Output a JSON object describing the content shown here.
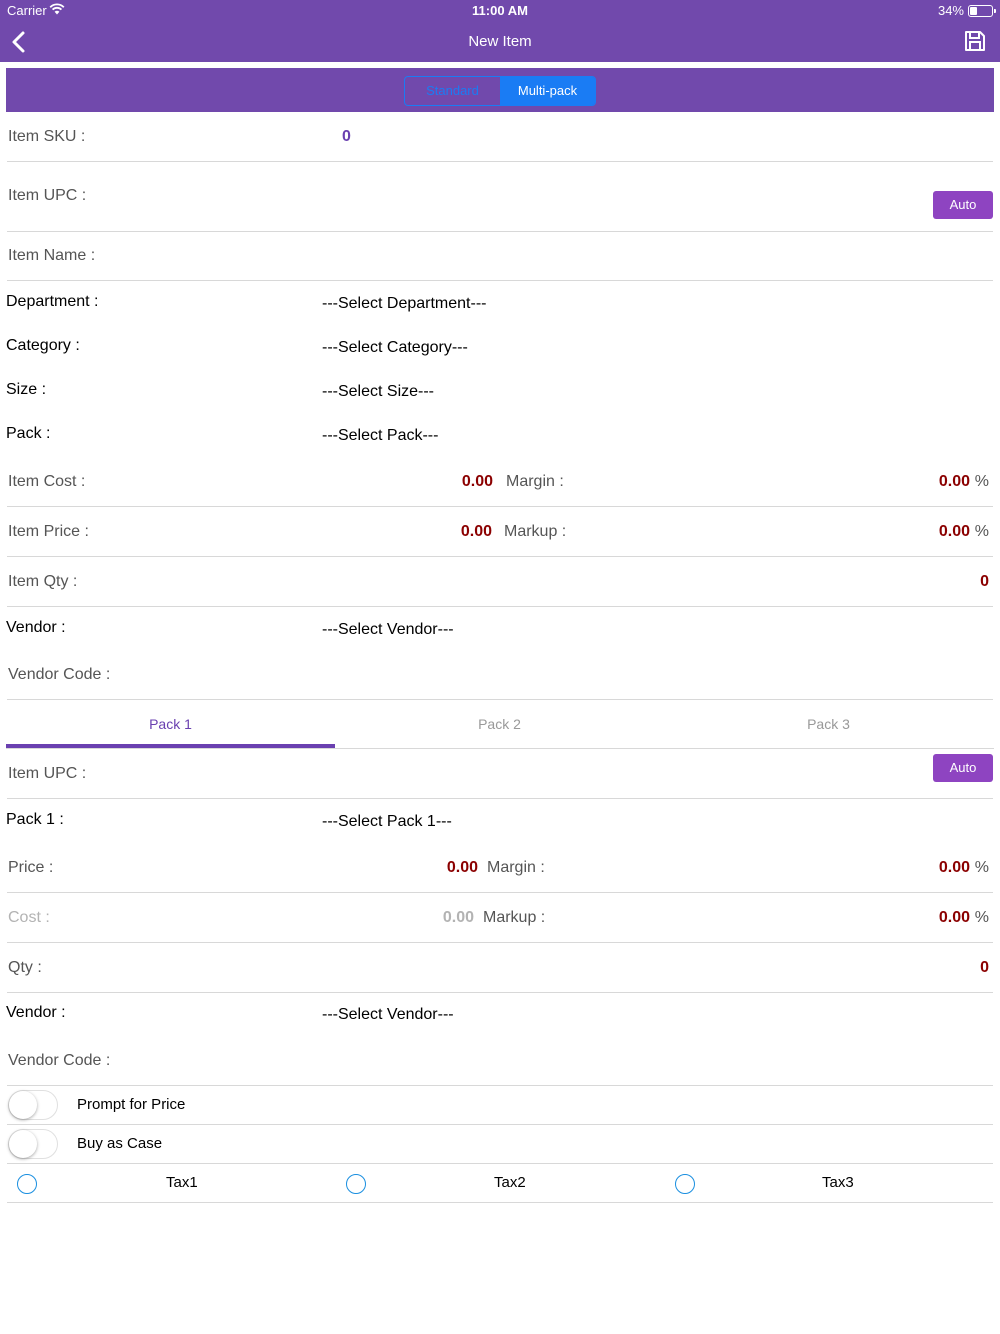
{
  "status_bar": {
    "carrier": "Carrier",
    "time": "11:00 AM",
    "battery": "34%"
  },
  "nav": {
    "title": "New Item",
    "back_icon": "chevron-left-icon",
    "save_icon": "floppy-disk-icon"
  },
  "segment": {
    "standard": "Standard",
    "multipack": "Multi-pack",
    "selected": "Multi-pack"
  },
  "item": {
    "sku_label": "Item SKU :",
    "sku_value": "0",
    "upc_label": "Item UPC :",
    "auto_label": "Auto",
    "name_label": "Item Name :",
    "department_label": "Department :",
    "department_value": "---Select Department---",
    "category_label": "Category :",
    "category_value": "---Select Category---",
    "size_label": "Size :",
    "size_value": "---Select Size---",
    "pack_label": "Pack :",
    "pack_value": "---Select Pack---",
    "cost_label": "Item Cost :",
    "cost_value": "0.00",
    "margin_label": "Margin :",
    "margin_value": "0.00",
    "percent": "%",
    "price_label": "Item Price :",
    "price_value": "0.00",
    "markup_label": "Markup :",
    "markup_value": "0.00",
    "qty_label": "Item Qty :",
    "qty_value": "0",
    "vendor_label": "Vendor :",
    "vendor_value": "---Select Vendor---",
    "vendor_code_label": "Vendor Code :"
  },
  "tabs": [
    "Pack 1",
    "Pack 2",
    "Pack 3"
  ],
  "pack": {
    "upc_label": "Item UPC :",
    "auto_label": "Auto",
    "pack_label": "Pack 1 :",
    "pack_value": "---Select Pack 1---",
    "price_label": "Price :",
    "price_value": "0.00",
    "margin_label": "Margin :",
    "margin_value": "0.00",
    "cost_label": "Cost :",
    "cost_value": "0.00",
    "markup_label": "Markup :",
    "markup_value": "0.00",
    "percent": "%",
    "qty_label": "Qty :",
    "qty_value": "0",
    "vendor_label": "Vendor :",
    "vendor_value": "---Select Vendor---",
    "vendor_code_label": "Vendor Code :"
  },
  "toggles": [
    {
      "label": "Prompt for Price",
      "on": false
    },
    {
      "label": "Buy as Case",
      "on": false
    }
  ],
  "taxes": [
    "Tax1",
    "Tax2",
    "Tax3"
  ],
  "colors": {
    "header": "#7149ac",
    "accent": "#6a40b0",
    "value_red": "#8b0000",
    "segment_blue": "#1a7cf4",
    "auto_button": "#8e44c1"
  }
}
